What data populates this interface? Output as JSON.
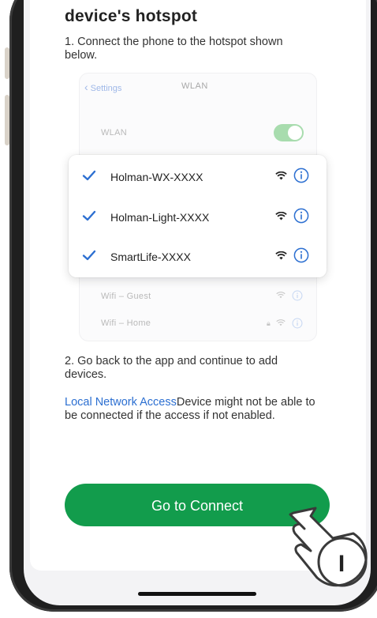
{
  "heading": "device's hotspot",
  "step1": "1. Connect the phone to the hotspot shown below.",
  "mock": {
    "back_label": "Settings",
    "title": "WLAN",
    "wlan_row": "WLAN",
    "networks": [
      "Holman-WX-XXXX",
      "Holman-Light-XXXX",
      "SmartLife-XXXX"
    ],
    "faint_networks": [
      "Wifi – Guest",
      "Wifi – Home"
    ]
  },
  "step2": "2. Go back to the app and continue to add devices.",
  "note": {
    "link_text": "Local Network Access",
    "text": "Device might not be able to be connected if the access if not enabled."
  },
  "connect_button": "Go to Connect",
  "hand_callout": "I",
  "colors": {
    "primary_green": "#129c4c",
    "link_blue": "#2c6fd1",
    "check_blue": "#2c6fd1",
    "toggle_green": "#a8dcae"
  }
}
